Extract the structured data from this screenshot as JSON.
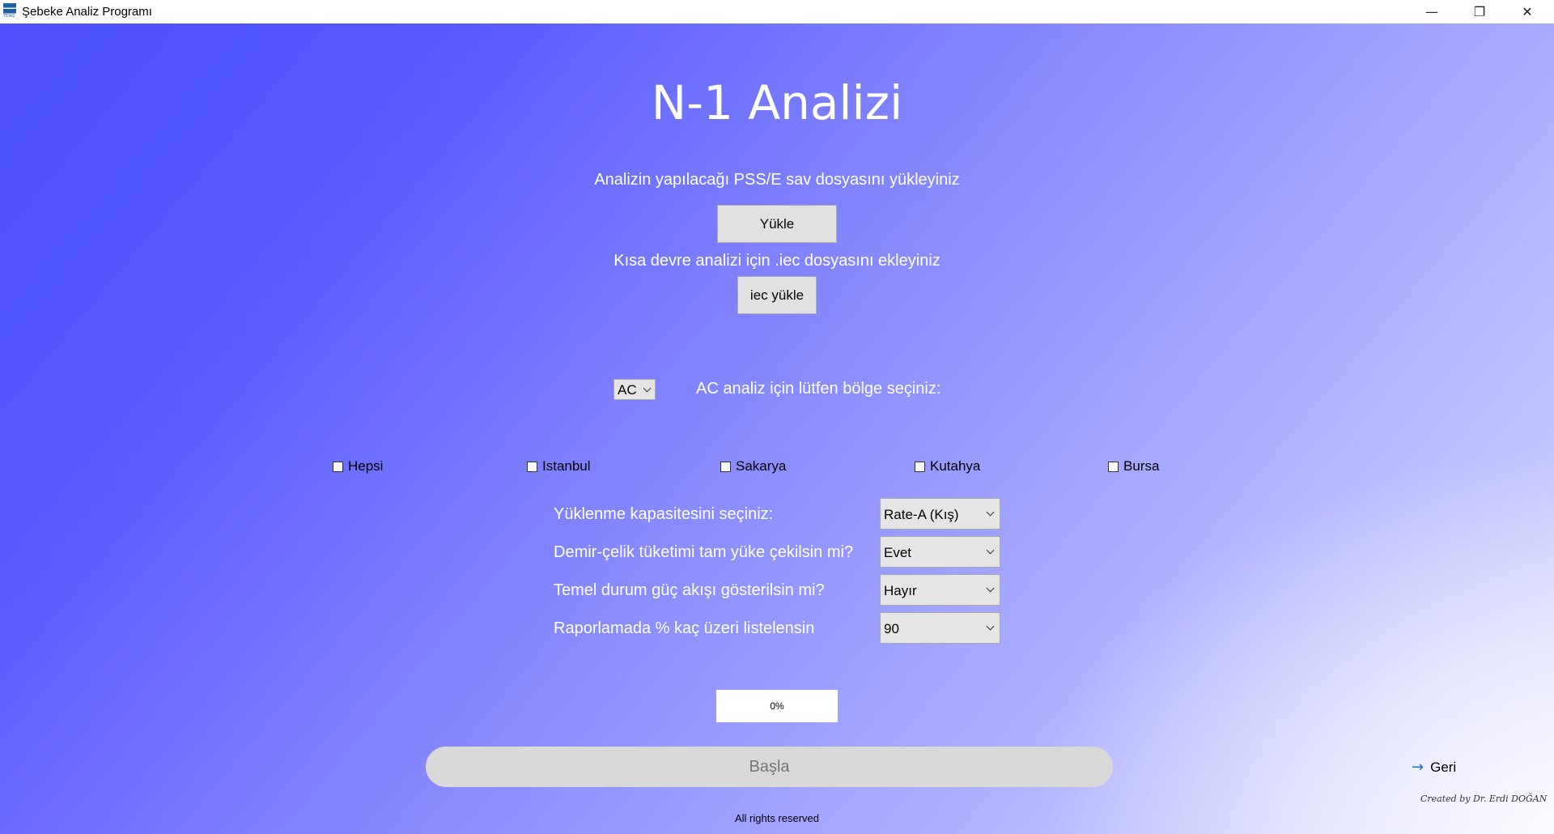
{
  "window": {
    "title": "Şebeke Analiz Programı",
    "icon_text": "TEİAŞ",
    "minimize_glyph": "—",
    "maximize_glyph": "❐",
    "close_glyph": "✕"
  },
  "page": {
    "title": "N-1 Analizi",
    "upload_prompt": "Analizin yapılacağı PSS/E sav dosyasını yükleyiniz",
    "upload_button": "Yükle",
    "iec_prompt": "Kısa devre analizi için .iec dosyasını ekleyiniz",
    "iec_button": "iec yükle",
    "analysis_type": {
      "selected": "AC"
    },
    "region_prompt": "AC analiz için lütfen bölge seçiniz:",
    "regions": [
      {
        "label": "Hepsi",
        "checked": false
      },
      {
        "label": "Istanbul",
        "checked": false
      },
      {
        "label": "Sakarya",
        "checked": false
      },
      {
        "label": "Kutahya",
        "checked": false
      },
      {
        "label": "Bursa",
        "checked": false
      }
    ],
    "options": [
      {
        "label": "Yüklenme kapasitesini seçiniz:",
        "value": "Rate-A (Kış)"
      },
      {
        "label": "Demir-çelik tüketimi tam yüke çekilsin mi?",
        "value": "Evet"
      },
      {
        "label": "Temel durum güç akışı gösterilsin mi?",
        "value": "Hayır"
      },
      {
        "label": "Raporlamada % kaç üzeri listelensin",
        "value": "90"
      }
    ],
    "progress": {
      "text": "0%",
      "value": 0
    },
    "start_button": "Başla",
    "back_link": "Geri",
    "back_icon": "arrow-right-icon",
    "credit": "Created by Dr. Erdi DOĞAN",
    "rights": "All rights reserved"
  },
  "colors": {
    "gradient_start": "#4f52fe",
    "gradient_end": "#d7d8ff",
    "button_bg": "#e1e1e1",
    "start_button_bg": "#d9d9d9",
    "link_arrow": "#1e6fd9"
  }
}
